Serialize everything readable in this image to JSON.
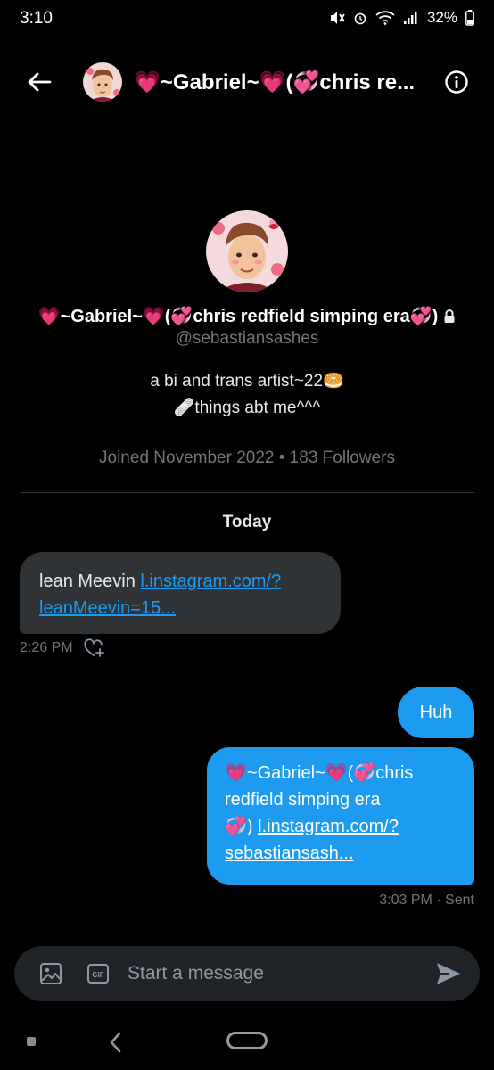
{
  "status_bar": {
    "time": "3:10",
    "battery": "32%"
  },
  "header": {
    "title": "💗~Gabriel~💗(💞chris re..."
  },
  "profile": {
    "name": "💗~Gabriel~💗(💞chris redfield simping era💞)",
    "handle": "@sebastiansashes",
    "bio_line1": "a bi and trans artist~22🥯",
    "bio_line2": "🩹things abt me^^^",
    "meta": "Joined November 2022 • 183 Followers"
  },
  "conversation": {
    "date_label": "Today",
    "messages": [
      {
        "text_prefix": "lean Meevin ",
        "link_line1": "l.instagram.com/?",
        "link_line2": "leanMeevin=15...",
        "time": "2:26 PM"
      },
      {
        "text": "Huh"
      },
      {
        "text_line1": "💗~Gabriel~💗(💞chris",
        "text_line2": "redfield simping era",
        "text_line3_prefix": "💞) ",
        "link_line1": "l.instagram.com/?",
        "link_line2": "sebastiansash...",
        "time": "3:03 PM · Sent"
      }
    ]
  },
  "composer": {
    "placeholder": "Start a message"
  },
  "colors": {
    "background": "#000000",
    "accent": "#1d9bf0",
    "incoming_bubble": "#2f3336",
    "secondary_text": "#71767b",
    "heart": "#f5326b"
  },
  "icons": [
    "back-arrow-icon",
    "info-icon",
    "lock-icon",
    "react-heart-plus-icon",
    "image-icon",
    "gif-icon",
    "send-icon",
    "mute-icon",
    "alarm-icon",
    "wifi-icon",
    "signal-icon",
    "battery-icon"
  ]
}
